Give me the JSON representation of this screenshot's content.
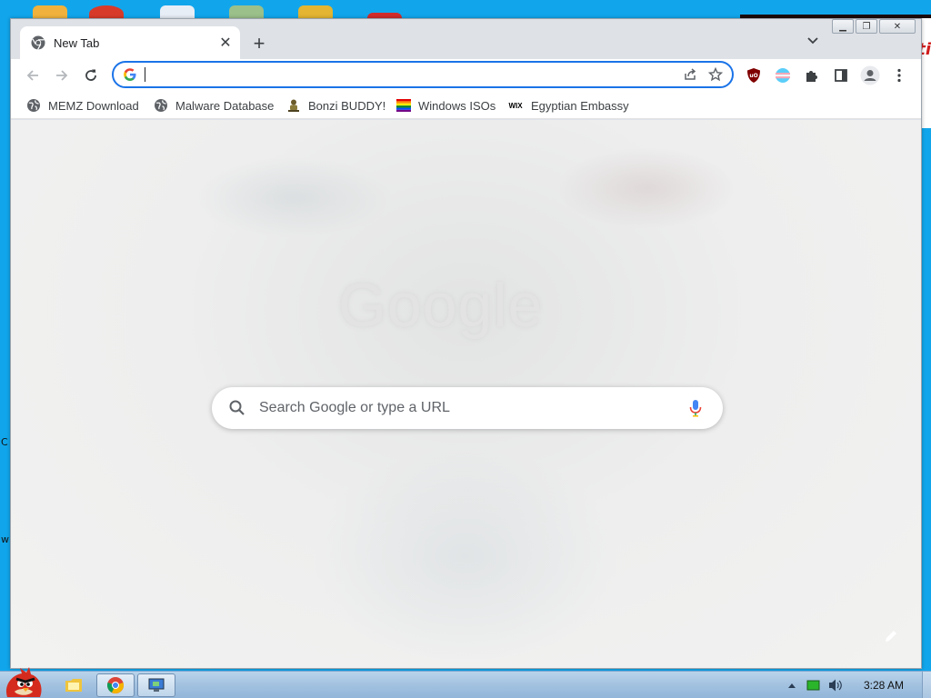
{
  "browser": {
    "tab": {
      "title": "New Tab"
    },
    "omnibox": {
      "value": "",
      "placeholder": ""
    },
    "bookmarks": [
      {
        "label": "MEMZ Download",
        "icon": "globe-icon"
      },
      {
        "label": "Malware Database",
        "icon": "globe-icon"
      },
      {
        "label": "Bonzi BUDDY!",
        "icon": "bonzi-icon"
      },
      {
        "label": "Windows ISOs",
        "icon": "rainbow-flag-icon"
      },
      {
        "label": "Egyptian Embassy",
        "icon": "wix-icon"
      }
    ],
    "wix_icon_text": "WIX"
  },
  "new_tab_page": {
    "logo_text": "Google",
    "search_placeholder": "Search Google or type a URL"
  },
  "taskbar": {
    "clock": "3:28 AM"
  },
  "desktop": {
    "edge_letters": [
      "C",
      "w"
    ],
    "right_text": "ti"
  },
  "colors": {
    "accent": "#1a73e8",
    "desktop": "#11a6ec",
    "ublock": "#800000"
  }
}
